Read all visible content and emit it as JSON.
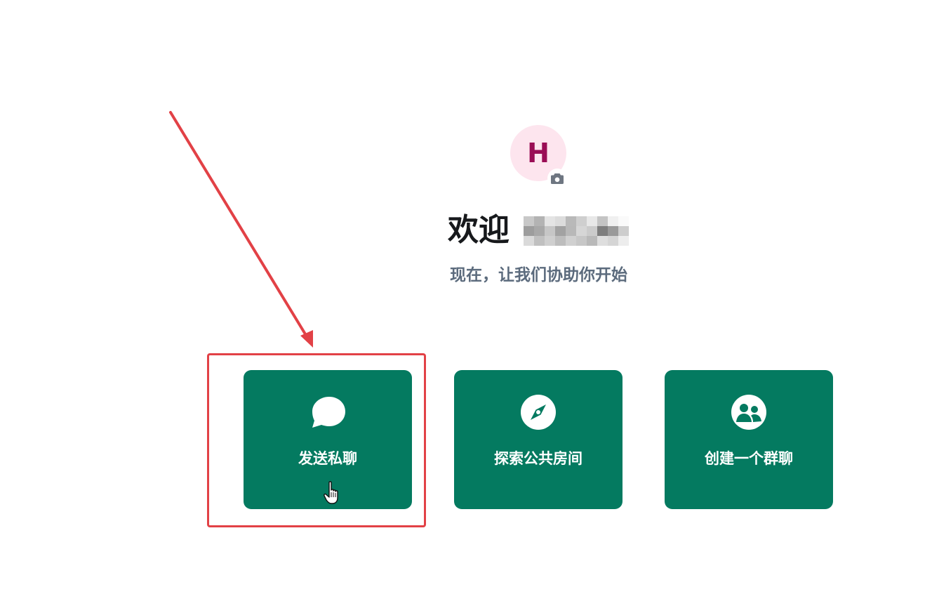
{
  "avatar": {
    "initial": "H",
    "bg_color": "#fde5ee",
    "text_color": "#9a0d55",
    "camera_icon": "camera-icon"
  },
  "welcome": {
    "title": "欢迎",
    "name_redacted": true,
    "subtitle": "现在，让我们协助你开始"
  },
  "actions": [
    {
      "label": "发送私聊",
      "icon": "chat-bubble-icon"
    },
    {
      "label": "探索公共房间",
      "icon": "compass-icon"
    },
    {
      "label": "创建一个群聊",
      "icon": "group-icon"
    }
  ],
  "colors": {
    "accent": "#047a60",
    "annotation": "#e24146",
    "title_text": "#17191c",
    "subtitle_text": "#5c6b7d"
  },
  "annotation": {
    "arrow_icon": "arrow-icon",
    "highlight_target": "发送私聊"
  }
}
